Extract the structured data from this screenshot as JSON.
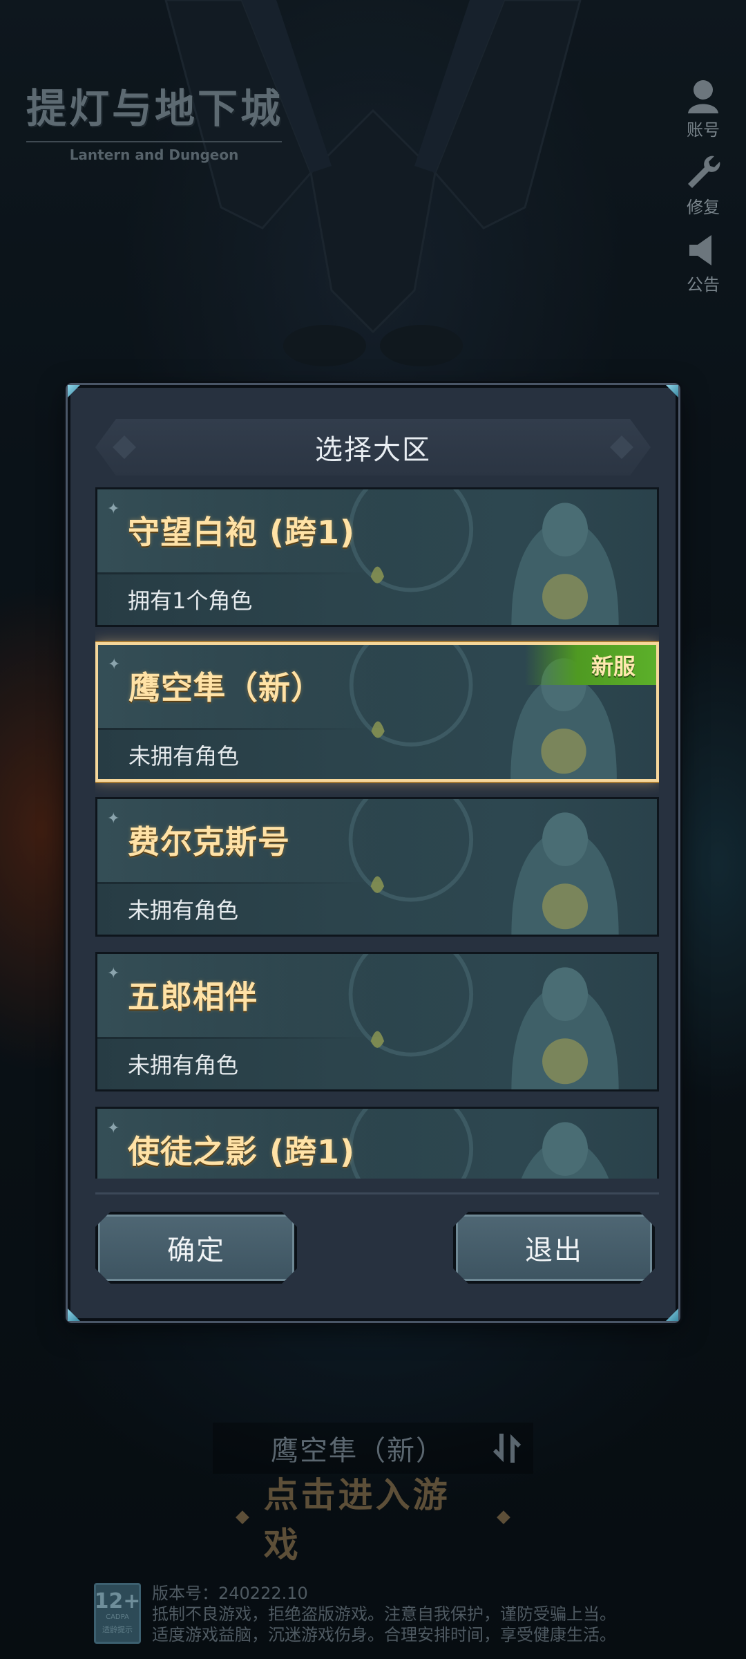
{
  "logo": {
    "title": "提灯与地下城",
    "subtitle": "Lantern and Dungeon"
  },
  "side_menu": [
    {
      "label": "账号",
      "icon": "account-icon"
    },
    {
      "label": "修复",
      "icon": "wrench-icon"
    },
    {
      "label": "公告",
      "icon": "megaphone-icon"
    }
  ],
  "modal": {
    "title": "选择大区",
    "servers": [
      {
        "name": "守望白袍 (跨1)",
        "status": "拥有1个角色",
        "selected": false
      },
      {
        "name": "鹰空隼（新）",
        "status": "未拥有角色",
        "selected": true,
        "badge": "新服"
      },
      {
        "name": "费尔克斯号",
        "status": "未拥有角色",
        "selected": false
      },
      {
        "name": "五郎相伴",
        "status": "未拥有角色",
        "selected": false
      },
      {
        "name": "使徒之影 (跨1)",
        "status": "",
        "selected": false
      }
    ],
    "confirm_label": "确定",
    "exit_label": "退出"
  },
  "bottom": {
    "current_server": "鹰空隼（新）",
    "enter_game": "点击进入游戏",
    "age_rating": "12+",
    "age_org": "CADPA",
    "age_tip": "适龄提示",
    "version": "版本号：240222.10",
    "notice_line1": "抵制不良游戏，拒绝盗版游戏。注意自我保护，谨防受骗上当。",
    "notice_line2": "适度游戏益脑，沉迷游戏伤身。合理安排时间，享受健康生活。"
  },
  "colors": {
    "server_name": "#ffe2a6",
    "selected_border": "#f6d79a",
    "new_badge": "#5cb02a",
    "modal_bg": "#27313f"
  }
}
